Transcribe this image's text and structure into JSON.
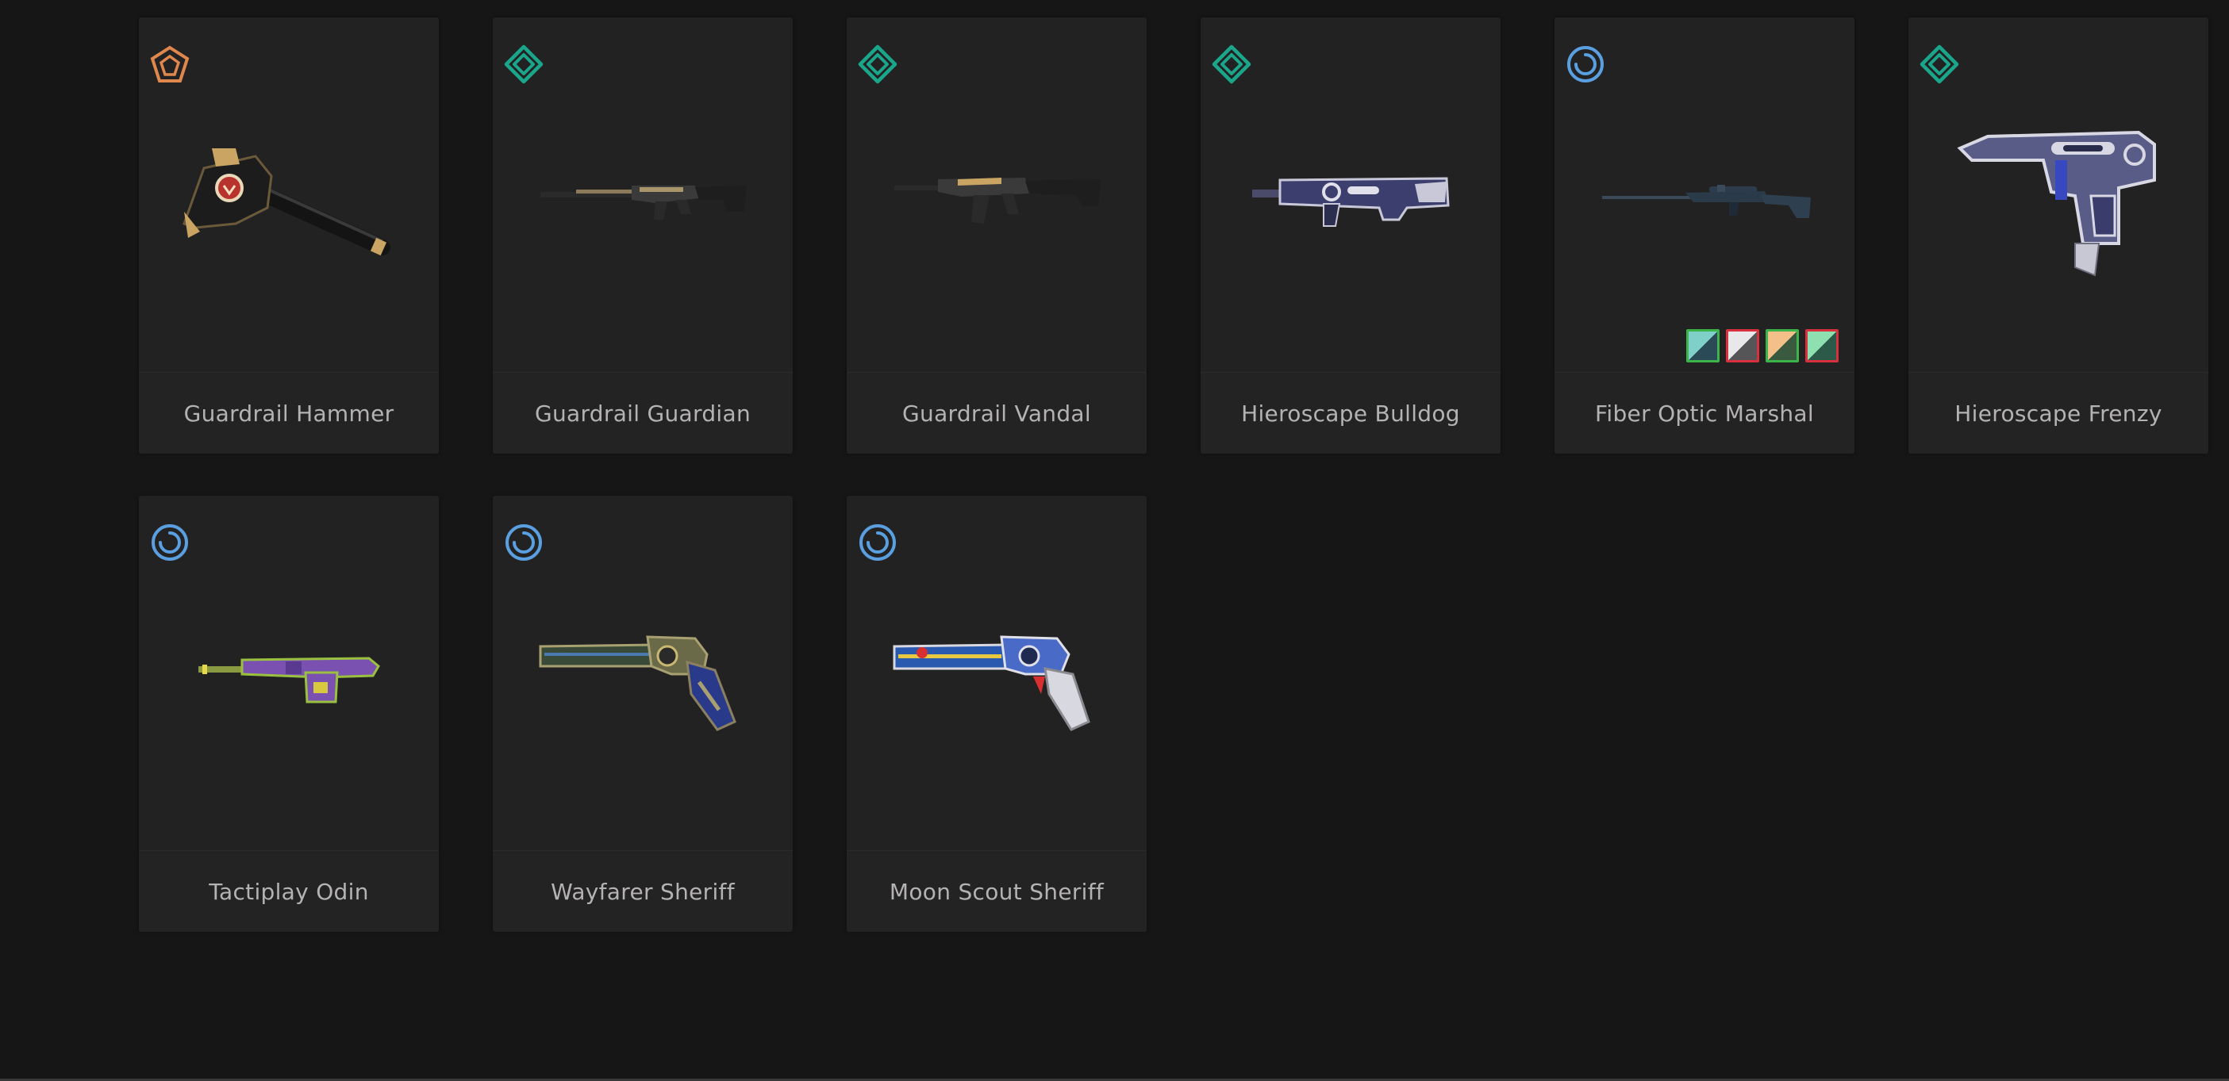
{
  "skins": [
    {
      "name": "Guardrail Hammer",
      "tier_icon": "premium-tier-icon",
      "tier_color": "#e0874d",
      "weapon_icon": "hammer-melee-icon"
    },
    {
      "name": "Guardrail Guardian",
      "tier_icon": "select-tier-icon",
      "tier_color": "#1aa68a",
      "weapon_icon": "guardian-rifle-icon"
    },
    {
      "name": "Guardrail Vandal",
      "tier_icon": "select-tier-icon",
      "tier_color": "#1aa68a",
      "weapon_icon": "vandal-rifle-icon"
    },
    {
      "name": "Hieroscape Bulldog",
      "tier_icon": "select-tier-icon",
      "tier_color": "#1aa68a",
      "weapon_icon": "bulldog-rifle-icon"
    },
    {
      "name": "Fiber Optic Marshal",
      "tier_icon": "deluxe-tier-icon",
      "tier_color": "#5a9fe0",
      "weapon_icon": "marshal-sniper-icon",
      "chromas": [
        {
          "name": "chroma-variant-1",
          "border": "#3bb54a",
          "fill": [
            "#7fd0c8",
            "#2a4a58"
          ]
        },
        {
          "name": "chroma-variant-2",
          "border": "#d8303c",
          "fill": [
            "#e8e8ea",
            "#555558"
          ]
        },
        {
          "name": "chroma-variant-3",
          "border": "#3bb54a",
          "fill": [
            "#f4c08a",
            "#3a5a40"
          ]
        },
        {
          "name": "chroma-variant-4",
          "border": "#d8303c",
          "fill": [
            "#8fe0b0",
            "#2c5a48"
          ]
        }
      ]
    },
    {
      "name": "Hieroscape Frenzy",
      "tier_icon": "select-tier-icon",
      "tier_color": "#1aa68a",
      "weapon_icon": "frenzy-pistol-icon"
    },
    {
      "name": "Tactiplay Odin",
      "tier_icon": "deluxe-tier-icon",
      "tier_color": "#5a9fe0",
      "weapon_icon": "odin-heavy-icon"
    },
    {
      "name": "Wayfarer Sheriff",
      "tier_icon": "deluxe-tier-icon",
      "tier_color": "#5a9fe0",
      "weapon_icon": "sheriff-revolver-icon"
    },
    {
      "name": "Moon Scout Sheriff",
      "tier_icon": "deluxe-tier-icon",
      "tier_color": "#5a9fe0",
      "weapon_icon": "sheriff-revolver-icon"
    }
  ]
}
